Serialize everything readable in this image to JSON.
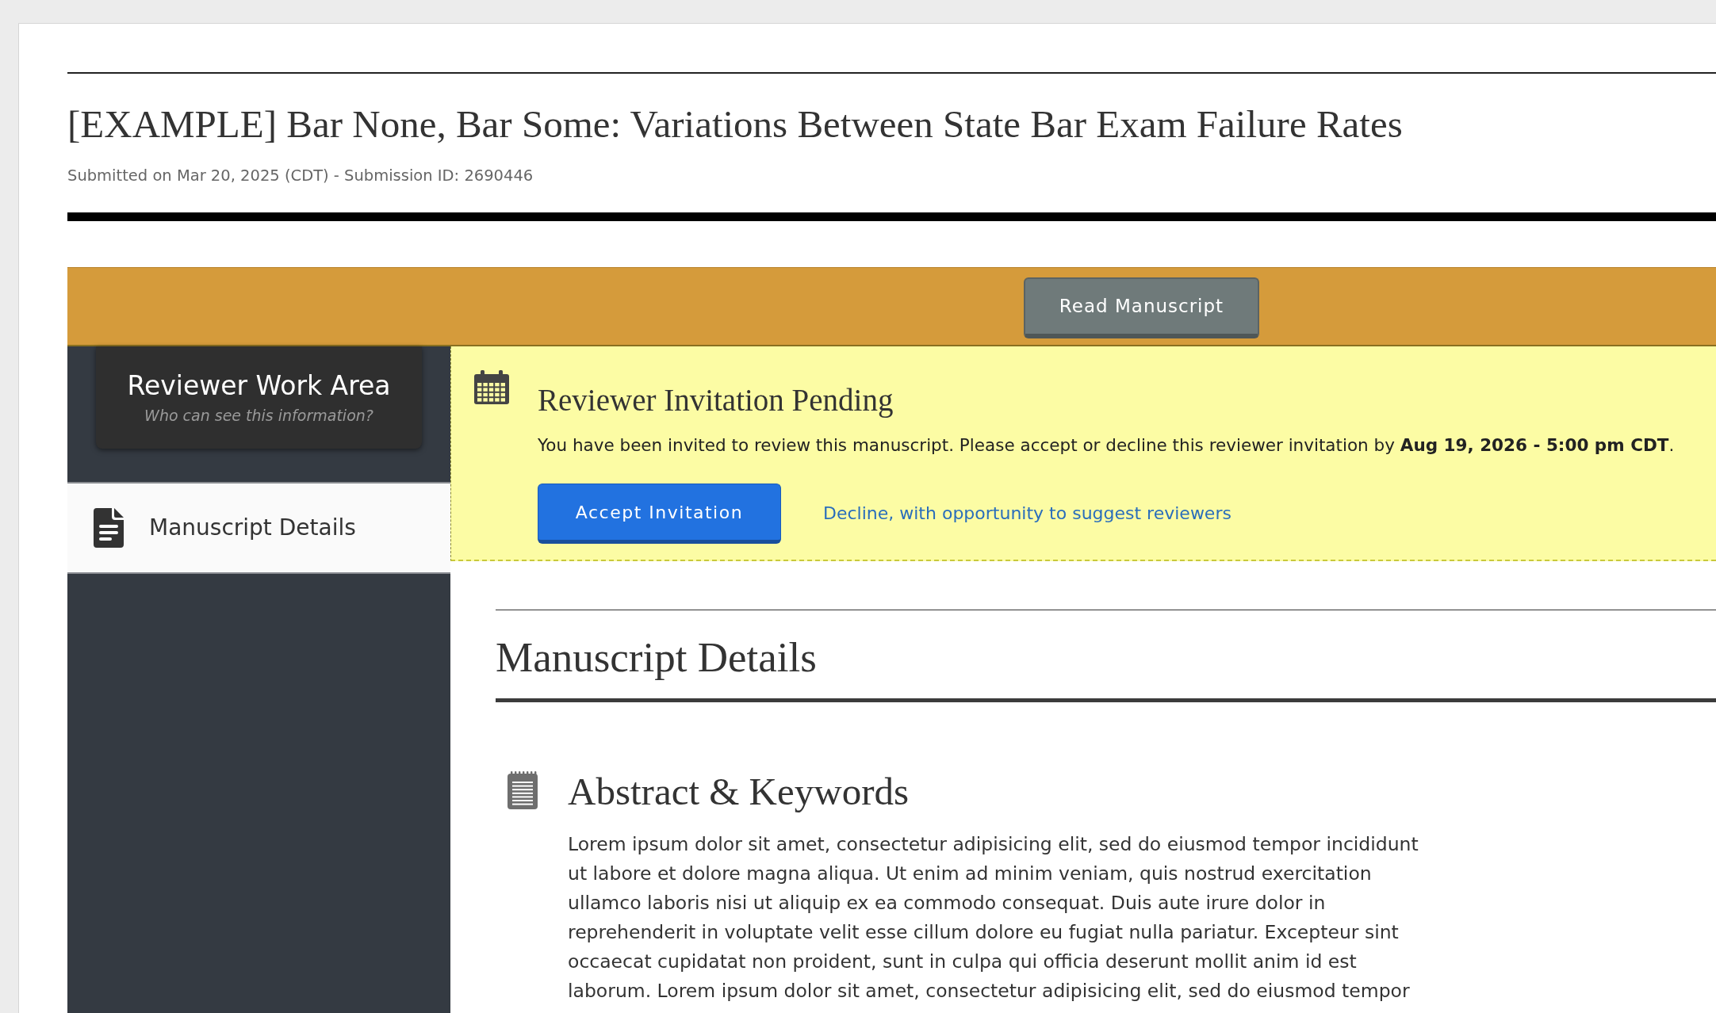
{
  "submission": {
    "title": "[EXAMPLE] Bar None, Bar Some: Variations Between State Bar Exam Failure Rates",
    "meta": "Submitted on Mar 20, 2025 (CDT) - Submission ID: 2690446"
  },
  "toolbar": {
    "button": "Read Manuscript"
  },
  "sidebar": {
    "work_area": {
      "title": "Reviewer Work Area",
      "link": "Who can see this information?"
    },
    "items": [
      {
        "label": "Manuscript Details",
        "selected": true
      }
    ]
  },
  "invitation": {
    "title": "Reviewer Invitation Pending",
    "message": "You have been invited to review this manuscript. Please accept or decline this reviewer invitation by **Aug 19, 2026 - 5:00 pm CDT**.",
    "accept_button": "Accept Invitation",
    "decline_link": "Decline, with opportunity to suggest reviewers"
  },
  "section": {
    "title": "Manuscript Details",
    "subsections": [
      {
        "title": "Abstract & Keywords",
        "text": "Lorem ipsum dolor sit amet, consectetur adipisicing elit, sed do eiusmod tempor incididunt ut labore et dolore magna aliqua. Ut enim ad minim veniam, quis nostrud exercitation ullamco laboris nisi ut aliquip ex ea commodo consequat. Duis aute irure dolor in reprehenderit in voluptate velit esse cillum dolore eu fugiat nulla pariatur. Excepteur sint occaecat cupidatat non proident, sunt in culpa qui officia deserunt mollit anim id est laborum. Lorem ipsum dolor sit amet, consectetur adipisicing elit, sed do eiusmod tempor"
      }
    ]
  }
}
